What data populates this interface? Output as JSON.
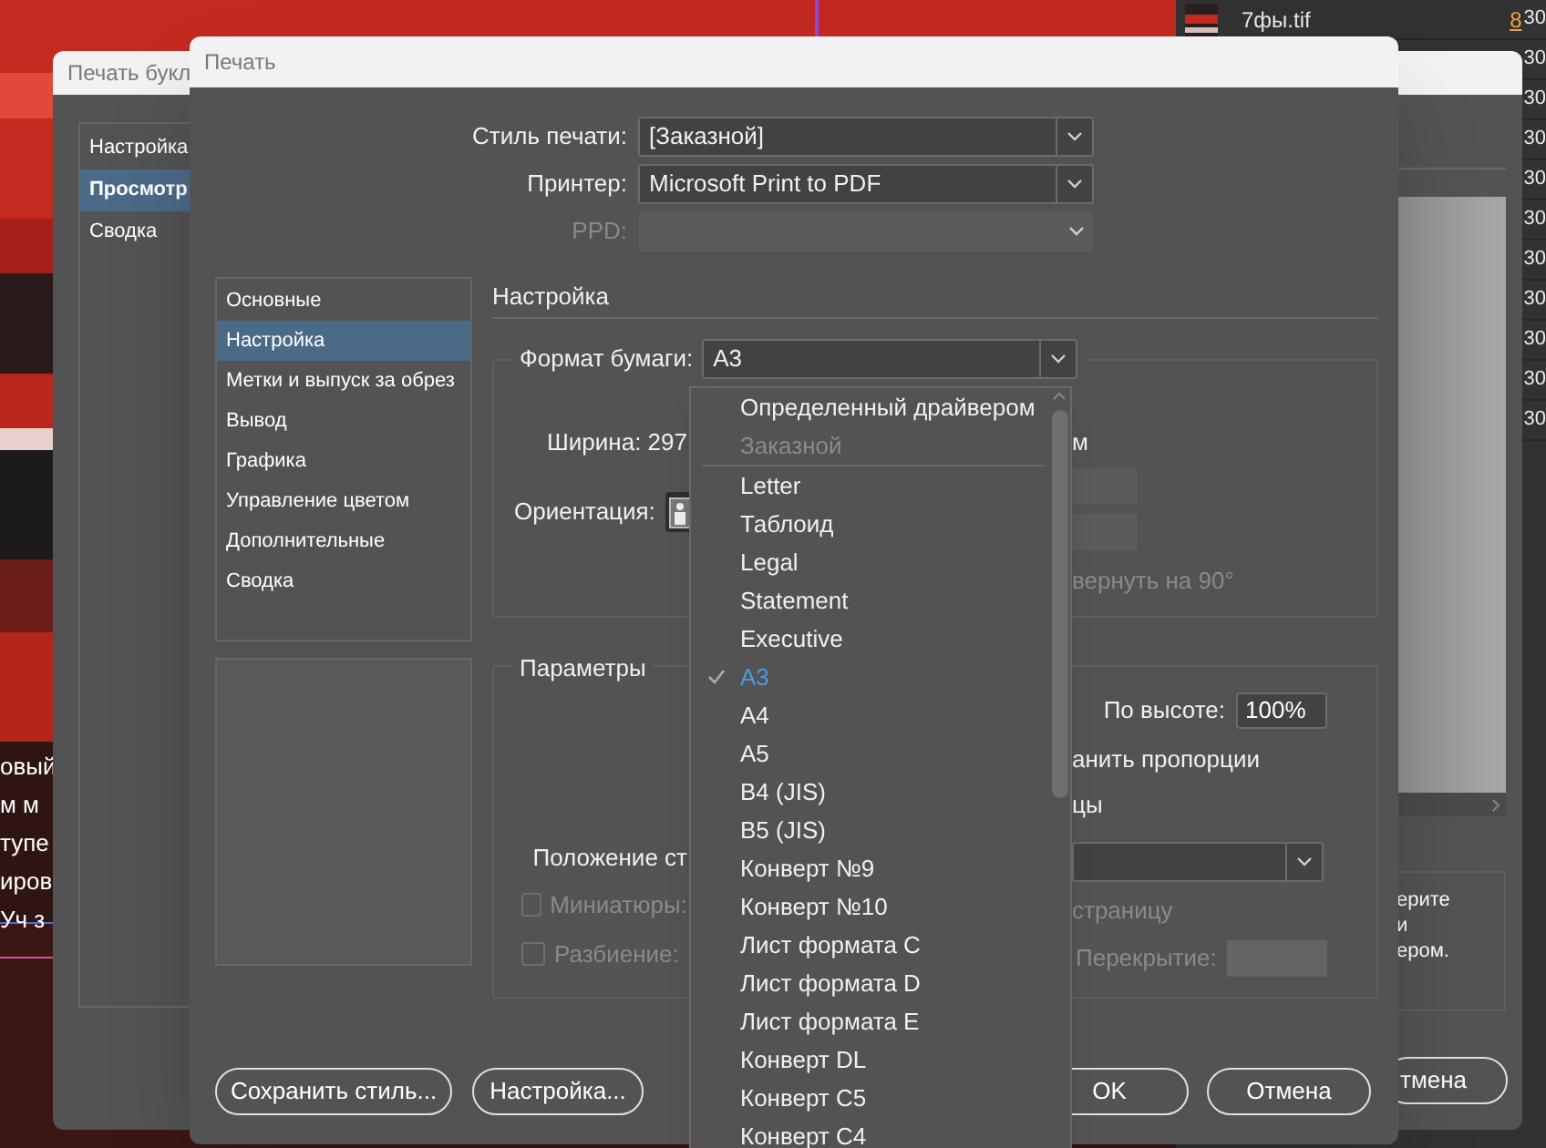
{
  "background": {
    "document_lines": [
      "овый",
      "м м",
      "тупе",
      "иров",
      "Уч з"
    ],
    "links_panel": {
      "file_name": "7фы.tif",
      "link_count": "8",
      "rows": [
        "30",
        "30",
        "30",
        "30",
        "30",
        "30",
        "30",
        "30",
        "30",
        "30",
        "30"
      ]
    }
  },
  "back_dialog": {
    "title": "Печать букл",
    "nav": [
      {
        "label": "Настройка",
        "selected": false
      },
      {
        "label": "Просмотр",
        "selected": true
      },
      {
        "label": "Сводка",
        "selected": false
      }
    ],
    "info_lines": [
      "ерите",
      "и",
      "ером."
    ],
    "cancel_button": "тмена"
  },
  "dialog": {
    "title": "Печать",
    "print_style": {
      "label": "Стиль печати:",
      "value": "[Заказной]",
      "disabled": false
    },
    "printer": {
      "label": "Принтер:",
      "value": "Microsoft Print to PDF",
      "disabled": false
    },
    "ppd": {
      "label": "PPD:",
      "disabled": true
    },
    "nav": [
      {
        "label": "Основные",
        "selected": false
      },
      {
        "label": "Настройка",
        "selected": true
      },
      {
        "label": "Метки и выпуск за обрез",
        "selected": false
      },
      {
        "label": "Вывод",
        "selected": false
      },
      {
        "label": "Графика",
        "selected": false
      },
      {
        "label": "Управление цветом",
        "selected": false
      },
      {
        "label": "Дополнительные",
        "selected": false
      },
      {
        "label": "Сводка",
        "selected": false
      }
    ],
    "section_title": "Настройка",
    "paper": {
      "label": "Формат бумаги:",
      "value": "A3",
      "width_label": "Ширина: 297",
      "unit_fragment": "м",
      "orientation_label": "Ориентация:",
      "rotate_fragment": "вернуть на 90°"
    },
    "options": {
      "legend": "Параметры",
      "height_label": "По высоте:",
      "height_value": "100%",
      "proportions_fragment": "анить пропорции",
      "fragment": "цы",
      "position_label": "Положение ст",
      "thumbnails": {
        "label": "Миниатюры:",
        "checked": false,
        "disabled": true
      },
      "page_fragment": "страницу",
      "tiling": {
        "label": "Разбиение:",
        "checked": false,
        "disabled": true
      },
      "overlap_label": "Перекрытие:"
    },
    "buttons": [
      "Сохранить стиль...",
      "Настройка...",
      "OK",
      "Отмена"
    ],
    "paper_menu": {
      "items": [
        {
          "kind": "item",
          "label": "Определенный драйвером",
          "selected": false,
          "disabled": false
        },
        {
          "kind": "item",
          "label": "Заказной",
          "selected": false,
          "disabled": true
        },
        {
          "kind": "separator"
        },
        {
          "kind": "item",
          "label": "Letter",
          "selected": false,
          "disabled": false
        },
        {
          "kind": "item",
          "label": "Таблоид",
          "selected": false,
          "disabled": false
        },
        {
          "kind": "item",
          "label": "Legal",
          "selected": false,
          "disabled": false
        },
        {
          "kind": "item",
          "label": "Statement",
          "selected": false,
          "disabled": false
        },
        {
          "kind": "item",
          "label": "Executive",
          "selected": false,
          "disabled": false
        },
        {
          "kind": "item",
          "label": "A3",
          "selected": true,
          "disabled": false
        },
        {
          "kind": "item",
          "label": "A4",
          "selected": false,
          "disabled": false
        },
        {
          "kind": "item",
          "label": "A5",
          "selected": false,
          "disabled": false
        },
        {
          "kind": "item",
          "label": "B4 (JIS)",
          "selected": false,
          "disabled": false
        },
        {
          "kind": "item",
          "label": "B5 (JIS)",
          "selected": false,
          "disabled": false
        },
        {
          "kind": "item",
          "label": "Конверт №9",
          "selected": false,
          "disabled": false
        },
        {
          "kind": "item",
          "label": "Конверт №10",
          "selected": false,
          "disabled": false
        },
        {
          "kind": "item",
          "label": "Лист формата C",
          "selected": false,
          "disabled": false
        },
        {
          "kind": "item",
          "label": "Лист формата D",
          "selected": false,
          "disabled": false
        },
        {
          "kind": "item",
          "label": "Лист формата E",
          "selected": false,
          "disabled": false
        },
        {
          "kind": "item",
          "label": "Конверт DL",
          "selected": false,
          "disabled": false
        },
        {
          "kind": "item",
          "label": "Конверт C5",
          "selected": false,
          "disabled": false
        },
        {
          "kind": "item",
          "label": "Конверт C4",
          "selected": false,
          "disabled": false
        }
      ]
    }
  }
}
